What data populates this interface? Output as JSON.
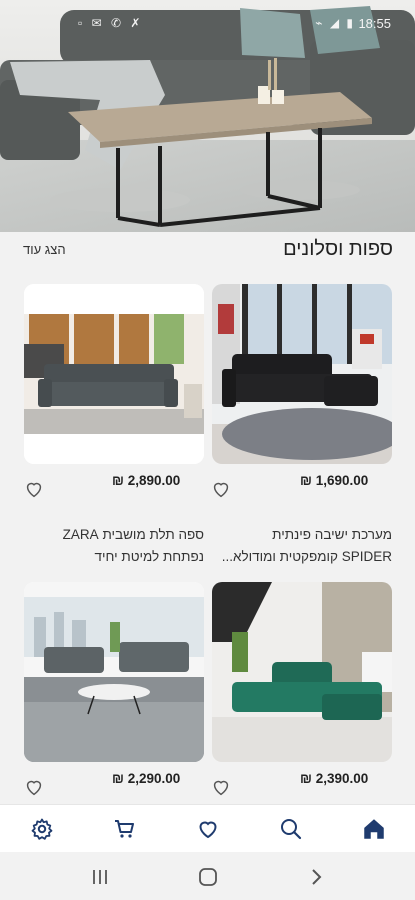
{
  "status_bar": {
    "time": "18:55",
    "left_icons": "▫ ✉ ✆ ✗",
    "right_icons": "⌁ ◢ ▮"
  },
  "section": {
    "title": "ספות וסלונים",
    "show_more": "הצג עוד"
  },
  "products": [
    {
      "price": "1,690.00 ₪",
      "name_line1": "מערכת ישיבה פינתית",
      "name_line2": "SPIDER קומפקטית ומודולא..."
    },
    {
      "price": "2,890.00 ₪",
      "name_line1": "ספה תלת מושבית ZARA",
      "name_line2": "נפתחת למיטת יחיד"
    },
    {
      "price": "2,390.00 ₪",
      "name_line1": "",
      "name_line2": ""
    },
    {
      "price": "2,290.00 ₪",
      "name_line1": "",
      "name_line2": ""
    }
  ],
  "bottom_nav": {
    "items": [
      "home-icon",
      "search-icon",
      "heart-icon",
      "cart-icon",
      "settings-icon"
    ],
    "active": "home-icon"
  },
  "colors": {
    "accent": "#1f3b6e",
    "background": "#f2f2f2"
  }
}
